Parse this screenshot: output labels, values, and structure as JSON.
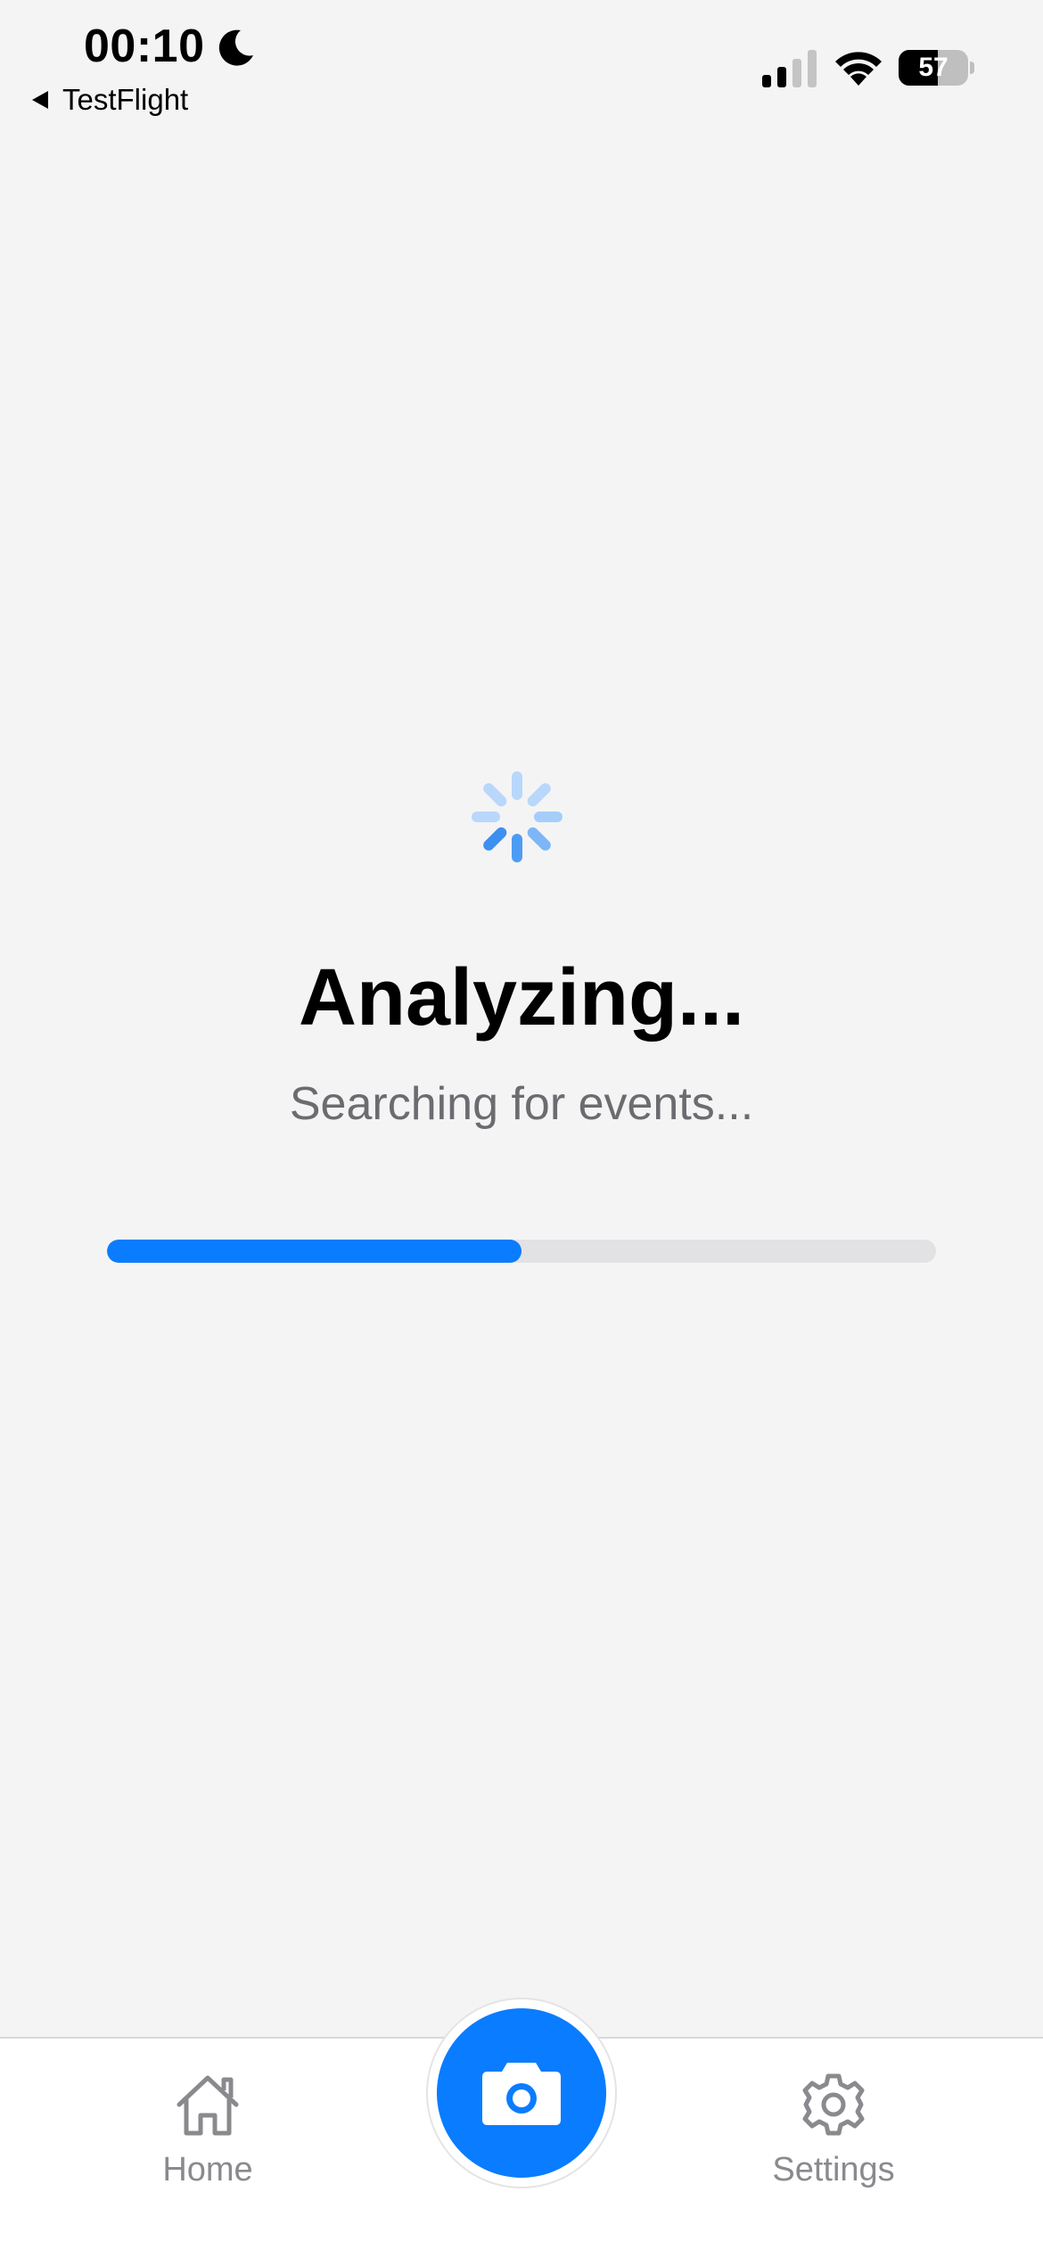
{
  "status_bar": {
    "time": "00:10",
    "back_app": "TestFlight",
    "battery_level": "57",
    "battery_fraction": 0.57,
    "icons": [
      "moon-icon",
      "signal-icon",
      "wifi-icon",
      "battery-icon"
    ]
  },
  "loading": {
    "title": "Analyzing...",
    "subtitle": "Searching for events...",
    "progress": 0.5,
    "spinner_icon": "activity-spinner-icon"
  },
  "tab_bar": {
    "home_label": "Home",
    "home_icon": "house-icon",
    "settings_label": "Settings",
    "settings_icon": "gear-icon",
    "camera_icon": "camera-icon"
  },
  "colors": {
    "accent": "#0a7cff",
    "background": "#f4f4f5",
    "track": "#e2e2e4",
    "tab_inactive": "#8a8a8e",
    "subtitle": "#6b6b70"
  }
}
